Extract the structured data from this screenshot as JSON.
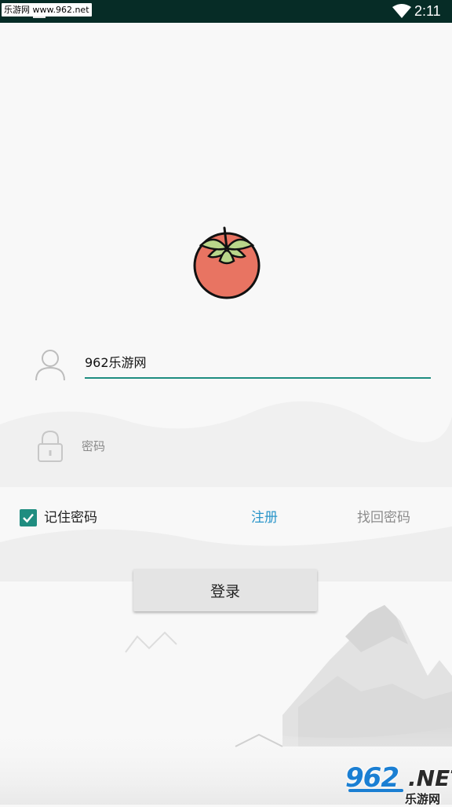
{
  "status_bar": {
    "watermark_label": "乐游网 www.962.net",
    "time": "2:11",
    "background_color": "#062c26",
    "icons": [
      "wifi-icon",
      "notification-icon"
    ]
  },
  "logo": {
    "icon": "tomato-logo",
    "colors": {
      "body": "#e87462",
      "leaf": "#b9d68a"
    }
  },
  "form": {
    "username": {
      "value": "962乐游网",
      "icon": "user-icon"
    },
    "password": {
      "placeholder": "密码",
      "value": "",
      "icon": "lock-icon"
    },
    "remember_label": "记住密码",
    "remember_checked": true,
    "register_label": "注册",
    "forgot_label": "找回密码",
    "login_label": "登录",
    "accent_color": "#1f8d80",
    "link_color": "#2a95c9"
  },
  "corner_watermark": {
    "number": "962",
    "suffix": ".NET",
    "cn": "乐游网"
  }
}
